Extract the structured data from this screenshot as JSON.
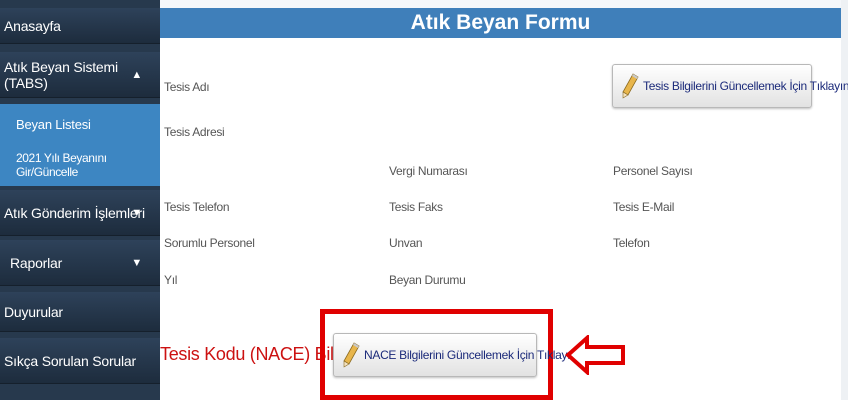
{
  "sidebar": {
    "items": [
      {
        "label": "Anasayfa"
      },
      {
        "label": "Atık Beyan Sistemi (TABS)",
        "caret": "▲"
      },
      {
        "label": "Beyan Listesi"
      },
      {
        "label": "2021 Yılı Beyanını Gir/Güncelle"
      },
      {
        "label": "Atık Gönderim İşlemleri",
        "caret": "▼"
      },
      {
        "label": "Raporlar",
        "caret": "▼"
      },
      {
        "label": "Duyurular"
      },
      {
        "label": "Sıkça Sorulan Sorular"
      }
    ]
  },
  "header": {
    "title": "Atık Beyan Formu"
  },
  "form": {
    "tesis_adi": "Tesis Adı",
    "tesis_adresi": "Tesis Adresi",
    "vergi_numarasi": "Vergi Numarası",
    "personel_sayisi": "Personel Sayısı",
    "tesis_telefon": "Tesis Telefon",
    "tesis_faks": "Tesis Faks",
    "tesis_email": "Tesis E-Mail",
    "sorumlu_personel": "Sorumlu Personel",
    "unvan": "Unvan",
    "telefon": "Telefon",
    "yil": "Yıl",
    "beyan_durumu": "Beyan Durumu",
    "update_facility_button": "Tesis Bilgilerini Güncellemek İçin Tıklayınız."
  },
  "nace": {
    "title": "Tesis Kodu (NACE) Bilgileri",
    "update_button": "NACE Bilgilerini Güncellemek İçin Tıklayınız."
  },
  "colors": {
    "sidebar_bg": "#27394d",
    "sidebar_active": "#1f7fbf",
    "header_bg": "#3f7fba",
    "highlight_red": "#e00000"
  },
  "icons": {
    "pencil": "pencil-icon",
    "arrow": "left-arrow-icon"
  }
}
